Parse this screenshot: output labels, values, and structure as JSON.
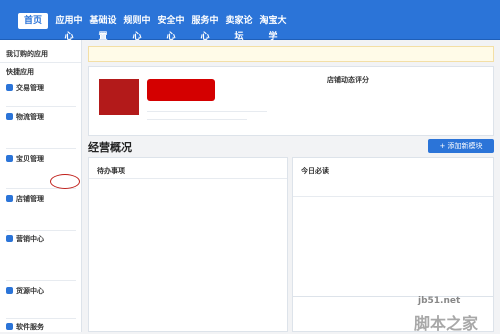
{
  "nav": {
    "items": [
      {
        "label": "首页",
        "active": true
      },
      {
        "label": "应用中心"
      },
      {
        "label": "基础设置"
      },
      {
        "label": "规则中心"
      },
      {
        "label": "安全中心"
      },
      {
        "label": "服务中心"
      },
      {
        "label": "卖家论坛"
      },
      {
        "label": "淘宝大学"
      }
    ],
    "right": ""
  },
  "side": {
    "myapps": "我订购的应用",
    "quick": "快捷应用",
    "sections": [
      {
        "title": "交易管理",
        "items": []
      },
      {
        "title": "物流管理",
        "items": []
      },
      {
        "title": "宝贝管理",
        "items": []
      },
      {
        "title": "店铺管理",
        "items": []
      },
      {
        "title": "营销中心",
        "items": []
      },
      {
        "title": "货源中心",
        "items": []
      },
      {
        "title": "软件服务",
        "items": []
      }
    ]
  },
  "notice": "",
  "store": {
    "logo_text": "",
    "dsr_title": "店铺动态评分",
    "dsr_cols": [
      "",
      "",
      "",
      ""
    ],
    "dsr_values": [
      "",
      "",
      "",
      ""
    ]
  },
  "overview": {
    "title": "经营概况",
    "link": "",
    "add_btn": "+ 添加新模块"
  },
  "todo": {
    "title": "待办事项",
    "tabs": [
      "",
      ""
    ],
    "rows": [],
    "more": ""
  },
  "read": {
    "title": "今日必读",
    "tabs": [
      "",
      ""
    ],
    "items": []
  },
  "news": {
    "title": "",
    "date": "",
    "items": []
  },
  "watermark": {
    "site": "jb51.net",
    "brand": "脚本之家"
  }
}
